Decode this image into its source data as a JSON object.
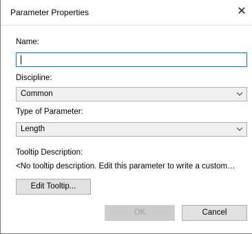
{
  "dialog": {
    "title": "Parameter Properties",
    "close_symbol": "✕"
  },
  "name": {
    "label": "Name:",
    "value": ""
  },
  "discipline": {
    "label": "Discipline:",
    "selected": "Common"
  },
  "type_of_parameter": {
    "label": "Type of Parameter:",
    "selected": "Length"
  },
  "tooltip": {
    "label": "Tooltip Description:",
    "text": "<No tooltip description. Edit this parameter to write a custom…",
    "edit_button": "Edit Tooltip..."
  },
  "footer": {
    "ok_label": "OK",
    "cancel_label": "Cancel"
  },
  "icons": {
    "close": "close-icon",
    "dropdown": "chevron-down-icon"
  }
}
